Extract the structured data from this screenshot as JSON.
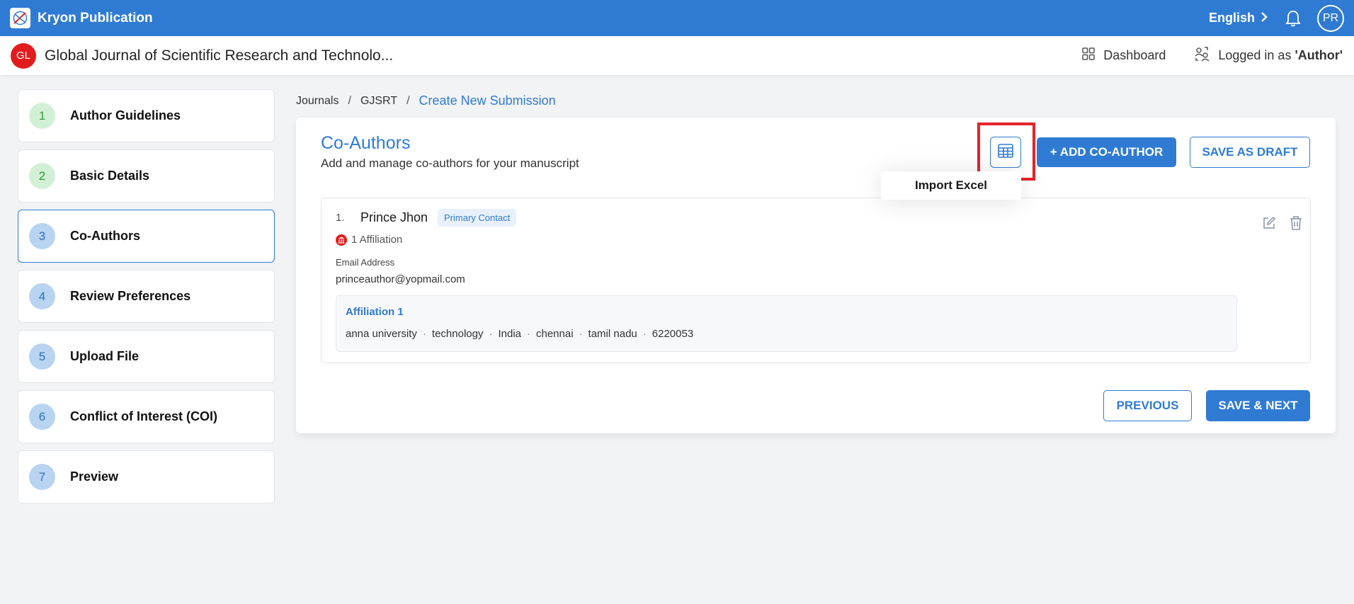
{
  "topbar": {
    "brand": "Kryon Publication",
    "language": "English",
    "avatar_initials": "PR"
  },
  "journal": {
    "badge": "GL",
    "title": "Global Journal of Scientific Research and Technolo...",
    "dashboard_label": "Dashboard",
    "logged_in_prefix": "Logged in as",
    "logged_in_role": "'Author'"
  },
  "steps": [
    {
      "num": "1",
      "label": "Author Guidelines",
      "state": "done"
    },
    {
      "num": "2",
      "label": "Basic Details",
      "state": "done"
    },
    {
      "num": "3",
      "label": "Co-Authors",
      "state": "active"
    },
    {
      "num": "4",
      "label": "Review Preferences",
      "state": "todo"
    },
    {
      "num": "5",
      "label": "Upload File",
      "state": "todo"
    },
    {
      "num": "6",
      "label": "Conflict of Interest (COI)",
      "state": "todo"
    },
    {
      "num": "7",
      "label": "Preview",
      "state": "todo"
    }
  ],
  "breadcrumb": {
    "items": [
      "Journals",
      "GJSRT"
    ],
    "current": "Create New Submission",
    "separator": "/"
  },
  "coauthors": {
    "title": "Co-Authors",
    "subtitle": "Add and manage co-authors for your manuscript",
    "import_tooltip": "Import Excel",
    "add_label": "+ ADD CO-AUTHOR",
    "draft_label": "SAVE AS DRAFT",
    "list": [
      {
        "index": "1.",
        "name": "Prince Jhon",
        "tag": "Primary Contact",
        "affiliation_count": "1 Affiliation",
        "email_label": "Email Address",
        "email": "princeauthor@yopmail.com",
        "affiliation_title": "Affiliation 1",
        "affiliation_parts": [
          "anna university",
          "technology",
          "India",
          "chennai",
          "tamil nadu",
          "6220053"
        ]
      }
    ]
  },
  "footer": {
    "previous_label": "PREVIOUS",
    "next_label": "SAVE & NEXT"
  },
  "colors": {
    "primary": "#2f7bd3",
    "highlight": "#e4232b",
    "badge_red": "#e01c1c",
    "done_bg": "#d2f0d5",
    "todo_bg": "#b8d4f1"
  },
  "icons": [
    "kryon-logo-icon",
    "chevron-right-icon",
    "bell-icon",
    "dashboard-grid-icon",
    "user-switch-icon",
    "table-excel-icon",
    "bank-icon",
    "edit-icon",
    "trash-icon"
  ]
}
